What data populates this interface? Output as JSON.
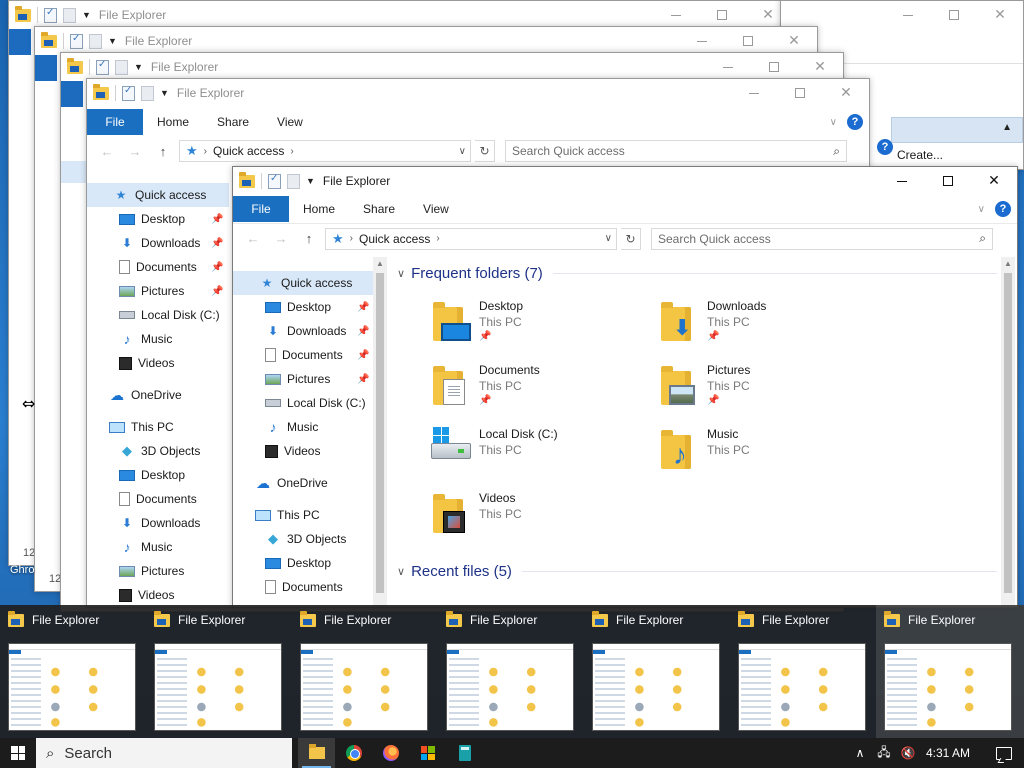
{
  "window": {
    "title": "File Explorer"
  },
  "ribbon": {
    "file": "File",
    "home": "Home",
    "share": "Share",
    "view": "View",
    "help": "?"
  },
  "address": {
    "location": "Quick access",
    "search_placeholder": "Search Quick access"
  },
  "right_window": {
    "create_label": "Create..."
  },
  "nav": {
    "quick_access": "Quick access",
    "pinned": [
      {
        "label": "Desktop",
        "icon": "desktop-icon"
      },
      {
        "label": "Downloads",
        "icon": "download-icon"
      },
      {
        "label": "Documents",
        "icon": "document-icon"
      },
      {
        "label": "Pictures",
        "icon": "picture-icon"
      }
    ],
    "local_disk": "Local Disk (C:)",
    "music": "Music",
    "videos": "Videos",
    "onedrive": "OneDrive",
    "this_pc": "This PC",
    "pc_items": [
      "3D Objects",
      "Desktop",
      "Documents",
      "Downloads",
      "Music",
      "Pictures",
      "Videos"
    ]
  },
  "content": {
    "frequent_header": "Frequent folders (7)",
    "recent_header": "Recent files (5)",
    "folders": [
      {
        "name": "Desktop",
        "location": "This PC",
        "pinned": true,
        "overlay": "desktop"
      },
      {
        "name": "Downloads",
        "location": "This PC",
        "pinned": true,
        "overlay": "download"
      },
      {
        "name": "Documents",
        "location": "This PC",
        "pinned": true,
        "overlay": "document"
      },
      {
        "name": "Pictures",
        "location": "This PC",
        "pinned": true,
        "overlay": "picture"
      },
      {
        "name": "Local Disk (C:)",
        "location": "This PC",
        "pinned": false,
        "overlay": "disk"
      },
      {
        "name": "Music",
        "location": "This PC",
        "pinned": false,
        "overlay": "music"
      },
      {
        "name": "Videos",
        "location": "This PC",
        "pinned": false,
        "overlay": "video"
      }
    ]
  },
  "desktop": {
    "label_a": "12",
    "label_b": "12",
    "label_c": "Ghro"
  },
  "thumbnails": [
    {
      "title": "File Explorer"
    },
    {
      "title": "File Explorer"
    },
    {
      "title": "File Explorer"
    },
    {
      "title": "File Explorer"
    },
    {
      "title": "File Explorer"
    },
    {
      "title": "File Explorer"
    },
    {
      "title": "File Explorer"
    }
  ],
  "taskbar": {
    "search_label": "Search",
    "time": "4:31 AM",
    "apps": [
      "file-explorer-icon",
      "chrome-icon",
      "firefox-icon",
      "windows-store-icon",
      "calculator-icon"
    ]
  },
  "colors": {
    "accent": "#1a6fc0",
    "header_text": "#1e3287",
    "selection": "#d9e8f8",
    "taskbar": "#1c1c1c"
  }
}
